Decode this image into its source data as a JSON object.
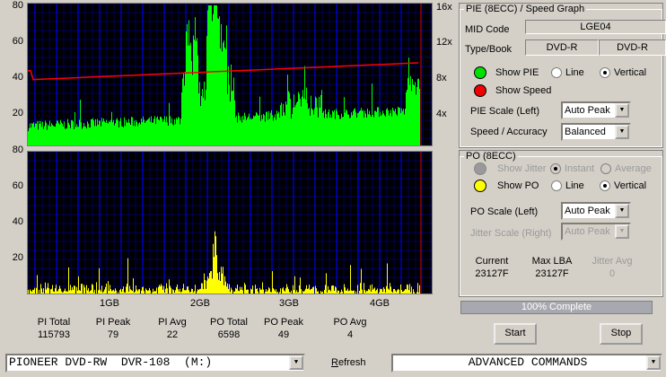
{
  "pie_chart": {
    "y_ticks": [
      "80",
      "60",
      "40",
      "20"
    ],
    "right_ticks": [
      "16x",
      "12x",
      "8x",
      "4x"
    ]
  },
  "po_chart": {
    "y_ticks": [
      "80",
      "60",
      "40",
      "20"
    ]
  },
  "x_ticks": [
    "1GB",
    "2GB",
    "3GB",
    "4GB"
  ],
  "stats": [
    {
      "label": "PI Total",
      "value": "115793"
    },
    {
      "label": "PI Peak",
      "value": "79"
    },
    {
      "label": "PI Avg",
      "value": "22"
    },
    {
      "label": "PO Total",
      "value": "6598"
    },
    {
      "label": "PO Peak",
      "value": "49"
    },
    {
      "label": "PO Avg",
      "value": "4"
    }
  ],
  "pie_panel": {
    "title": "PIE (8ECC) / Speed Graph",
    "mid_label": "MID Code",
    "mid_value": "LGE04",
    "type_label": "Type/Book",
    "type_value": "DVD-R",
    "book_value": "DVD-R",
    "show_pie": "Show PIE",
    "line": "Line",
    "vertical": "Vertical",
    "show_speed": "Show Speed",
    "scale_label": "PIE Scale (Left)",
    "scale_value": "Auto Peak",
    "accuracy_label": "Speed / Accuracy",
    "accuracy_value": "Balanced"
  },
  "po_panel": {
    "title": "PO (8ECC)",
    "show_jitter": "Show Jitter",
    "instant": "Instant",
    "average": "Average",
    "show_po": "Show PO",
    "line": "Line",
    "vertical": "Vertical",
    "scale_label": "PO Scale (Left)",
    "scale_value": "Auto Peak",
    "jitter_scale_label": "Jitter Scale (Right)",
    "jitter_scale_value": "Auto Peak",
    "current_label": "Current",
    "current_value": "23127F",
    "maxlba_label": "Max LBA",
    "maxlba_value": "23127F",
    "jitter_avg_label": "Jitter Avg",
    "jitter_avg_value": "0"
  },
  "progress": {
    "text": "100% Complete",
    "percent": 100
  },
  "buttons": {
    "start": "Start",
    "stop": "Stop",
    "refresh": "Refresh"
  },
  "drive": "PIONEER DVD-RW  DVR-108  (M:)",
  "advanced": "ADVANCED COMMANDS",
  "colors": {
    "pie": "#00ff00",
    "po": "#ffff00",
    "speed": "#ff0000",
    "grid": "#0000c0"
  }
}
